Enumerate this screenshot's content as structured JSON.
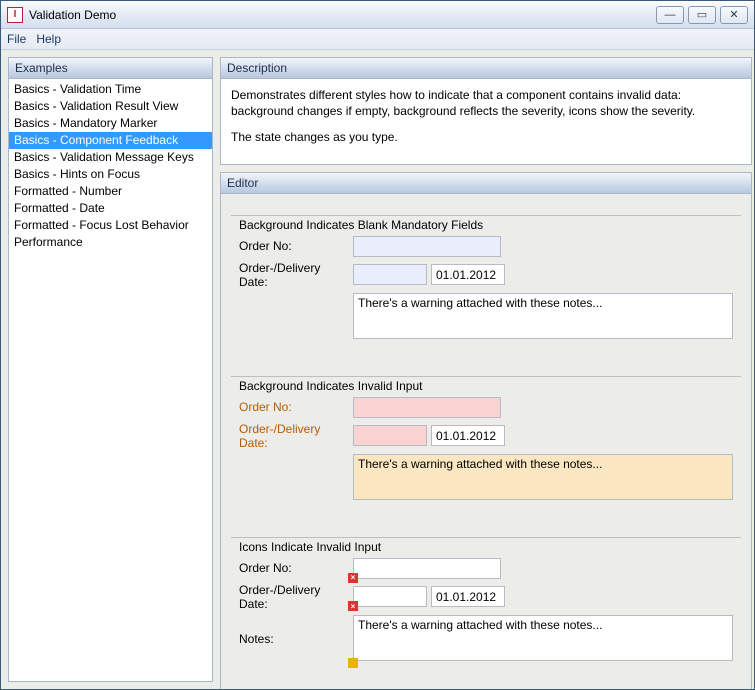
{
  "window": {
    "title": "Validation Demo"
  },
  "menu": {
    "file": "File",
    "help": "Help"
  },
  "sidebar": {
    "title": "Examples",
    "items": [
      {
        "label": "Basics - Validation Time",
        "selected": false
      },
      {
        "label": "Basics - Validation Result View",
        "selected": false
      },
      {
        "label": "Basics - Mandatory Marker",
        "selected": false
      },
      {
        "label": "Basics - Component Feedback",
        "selected": true
      },
      {
        "label": "Basics - Validation Message Keys",
        "selected": false
      },
      {
        "label": "Basics - Hints on Focus",
        "selected": false
      },
      {
        "label": "Formatted - Number",
        "selected": false
      },
      {
        "label": "Formatted - Date",
        "selected": false
      },
      {
        "label": "Formatted - Focus Lost Behavior",
        "selected": false
      },
      {
        "label": "Performance",
        "selected": false
      }
    ]
  },
  "description": {
    "title": "Description",
    "p1": "Demonstrates different styles how to indicate that a component contains invalid data: background changes if empty, background reflects the severity, icons show the severity.",
    "p2": "The state changes as you type."
  },
  "editor": {
    "title": "Editor",
    "groups": {
      "blank": {
        "title": "Background Indicates Blank Mandatory Fields",
        "order_label": "Order No:",
        "order_value": "",
        "delivery_label": "Order-/Delivery Date:",
        "date1_value": "",
        "date2_value": "01.01.2012",
        "notes_value": "There's a warning attached with these notes..."
      },
      "invalid": {
        "title": "Background Indicates Invalid Input",
        "order_label": "Order No:",
        "order_value": "",
        "delivery_label": "Order-/Delivery Date:",
        "date1_value": "",
        "date2_value": "01.01.2012",
        "notes_value": "There's a warning attached with these notes..."
      },
      "icons": {
        "title": "Icons Indicate Invalid Input",
        "order_label": "Order No:",
        "order_value": "",
        "delivery_label": "Order-/Delivery Date:",
        "date1_value": "",
        "date2_value": "01.01.2012",
        "notes_label": "Notes:",
        "notes_value": "There's a warning attached with these notes..."
      }
    }
  }
}
